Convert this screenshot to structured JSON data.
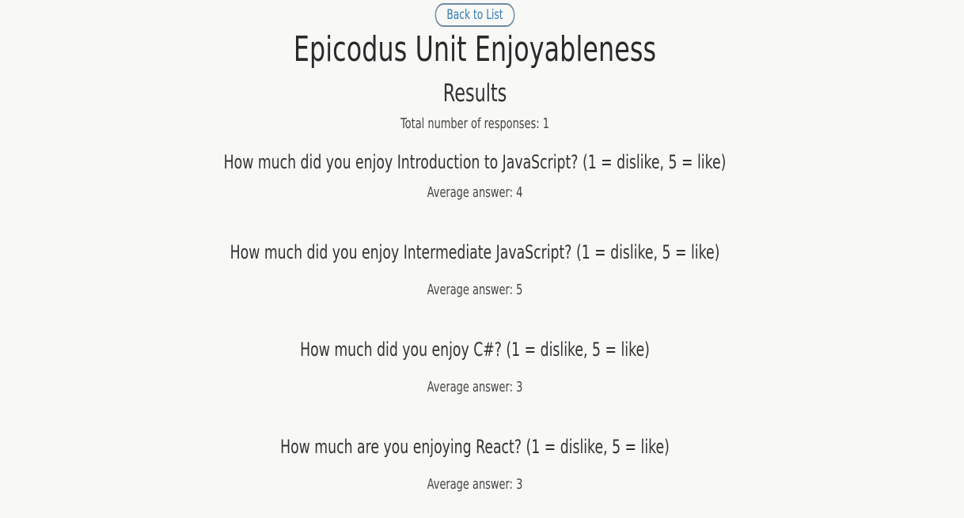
{
  "nav": {
    "back_label": "Back to List"
  },
  "page": {
    "title": "Epicodus Unit Enjoyableness",
    "subtitle": "Results",
    "total_responses": "Total number of responses: 1"
  },
  "questions": [
    {
      "text": "How much did you enjoy Introduction to JavaScript? (1 = dislike, 5 = like)",
      "average": "Average answer: 4"
    },
    {
      "text": "How much did you enjoy Intermediate JavaScript? (1 = dislike, 5 = like)",
      "average": "Average answer: 5"
    },
    {
      "text": "How much did you enjoy C#? (1 = dislike, 5 = like)",
      "average": "Average answer: 3"
    },
    {
      "text": "How much are you enjoying React? (1 = dislike, 5 = like)",
      "average": "Average answer: 3"
    }
  ]
}
